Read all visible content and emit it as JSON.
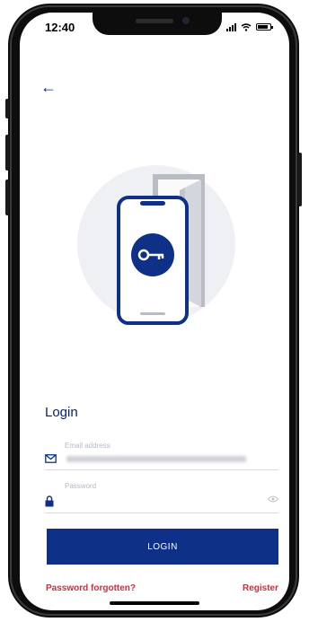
{
  "status_bar": {
    "time": "12:40"
  },
  "form": {
    "title": "Login",
    "email_placeholder": "Email address",
    "password_placeholder": "Password",
    "login_label": "LOGIN"
  },
  "links": {
    "forgot": "Password forgotten?",
    "register": "Register"
  },
  "colors": {
    "primary": "#0e3187",
    "title": "#0b1f66",
    "link": "#e0283a",
    "illustration_bg": "#eef0f4"
  },
  "icons": [
    "back-arrow-icon",
    "email-icon",
    "lock-icon",
    "eye-icon",
    "key-icon",
    "door-icon",
    "signal-icon",
    "wifi-icon",
    "battery-icon"
  ]
}
